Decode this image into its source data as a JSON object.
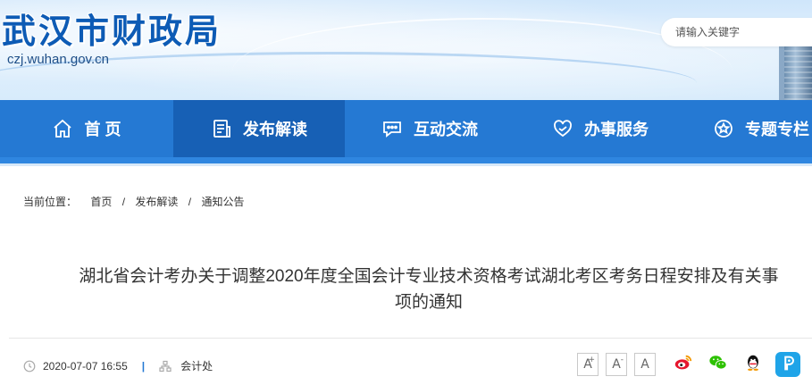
{
  "header": {
    "site_title": "武汉市财政局",
    "site_domain": "czj.wuhan.gov.cn",
    "search_placeholder": "请输入关键字"
  },
  "nav": {
    "items": [
      {
        "label": "首 页",
        "icon": "home-icon"
      },
      {
        "label": "发布解读",
        "icon": "document-icon",
        "active": true
      },
      {
        "label": "互动交流",
        "icon": "chat-icon"
      },
      {
        "label": "办事服务",
        "icon": "heart-hands-icon"
      },
      {
        "label": "专题专栏",
        "icon": "star-circle-icon"
      }
    ]
  },
  "breadcrumb": {
    "label": "当前位置：",
    "items": [
      "首页",
      "发布解读",
      "通知公告"
    ],
    "separator": "/"
  },
  "article": {
    "title_line1": "湖北省会计考办关于调整2020年度全国会计专业技术资格考试湖北考区考务日程安排及有关事",
    "title_line2": "项的通知",
    "date": "2020-07-07 16:55",
    "meta_separator": "|",
    "publisher": "会计处"
  },
  "font_size_buttons": [
    {
      "label": "A",
      "sup": "+"
    },
    {
      "label": "A",
      "sup": "-"
    },
    {
      "label": "A",
      "sup": ""
    }
  ],
  "share": [
    {
      "icon": "weibo-icon",
      "color": "#e6162d"
    },
    {
      "icon": "wechat-icon",
      "color": "#2dc100"
    },
    {
      "icon": "qq-icon",
      "color": "#1e9bd7"
    },
    {
      "icon": "qzone-icon",
      "color": "#1fa4e8"
    }
  ],
  "colors": {
    "brand_blue": "#2579d3",
    "nav_active": "#1760b5",
    "title_blue": "#0d5bb5"
  }
}
